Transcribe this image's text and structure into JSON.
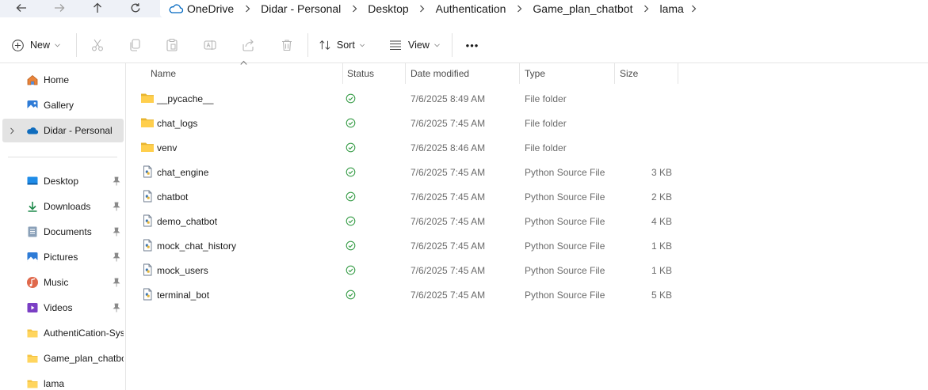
{
  "toolbar_nav": {
    "back_icon": "arrow-left-icon",
    "forward_icon": "arrow-right-icon",
    "up_icon": "arrow-up-icon",
    "refresh_icon": "refresh-icon"
  },
  "breadcrumb": {
    "items": [
      "OneDrive",
      "Didar - Personal",
      "Desktop",
      "Authentication",
      "Game_plan_chatbot",
      "lama"
    ]
  },
  "command_bar": {
    "new_label": "New",
    "sort_label": "Sort",
    "view_label": "View",
    "more_label": "•••"
  },
  "sidebar": {
    "top_items": [
      {
        "label": "Home",
        "icon": "home-icon"
      },
      {
        "label": "Gallery",
        "icon": "gallery-icon"
      },
      {
        "label": "Didar - Personal",
        "icon": "onedrive-icon",
        "selected": true
      }
    ],
    "quick_access": [
      {
        "label": "Desktop",
        "icon": "desktop-icon",
        "pinned": true
      },
      {
        "label": "Downloads",
        "icon": "download-icon",
        "pinned": true
      },
      {
        "label": "Documents",
        "icon": "documents-icon",
        "pinned": true
      },
      {
        "label": "Pictures",
        "icon": "pictures-icon",
        "pinned": true
      },
      {
        "label": "Music",
        "icon": "music-icon",
        "pinned": true
      },
      {
        "label": "Videos",
        "icon": "videos-icon",
        "pinned": true
      },
      {
        "label": "AuthentiCation-Sys",
        "icon": "folder-icon",
        "pinned": false
      },
      {
        "label": "Game_plan_chatbo",
        "icon": "folder-icon",
        "pinned": false
      },
      {
        "label": "lama",
        "icon": "folder-icon",
        "pinned": false
      }
    ]
  },
  "columns": {
    "name": "Name",
    "status": "Status",
    "date_modified": "Date modified",
    "type": "Type",
    "size": "Size"
  },
  "files": [
    {
      "name": "__pycache__",
      "date": "7/6/2025 8:49 AM",
      "type": "File folder",
      "size": "",
      "kind": "folder"
    },
    {
      "name": "chat_logs",
      "date": "7/6/2025 7:45 AM",
      "type": "File folder",
      "size": "",
      "kind": "folder"
    },
    {
      "name": "venv",
      "date": "7/6/2025 8:46 AM",
      "type": "File folder",
      "size": "",
      "kind": "folder"
    },
    {
      "name": "chat_engine",
      "date": "7/6/2025 7:45 AM",
      "type": "Python Source File",
      "size": "3 KB",
      "kind": "python"
    },
    {
      "name": "chatbot",
      "date": "7/6/2025 7:45 AM",
      "type": "Python Source File",
      "size": "2 KB",
      "kind": "python"
    },
    {
      "name": "demo_chatbot",
      "date": "7/6/2025 7:45 AM",
      "type": "Python Source File",
      "size": "4 KB",
      "kind": "python"
    },
    {
      "name": "mock_chat_history",
      "date": "7/6/2025 7:45 AM",
      "type": "Python Source File",
      "size": "1 KB",
      "kind": "python"
    },
    {
      "name": "mock_users",
      "date": "7/6/2025 7:45 AM",
      "type": "Python Source File",
      "size": "1 KB",
      "kind": "python"
    },
    {
      "name": "terminal_bot",
      "date": "7/6/2025 7:45 AM",
      "type": "Python Source File",
      "size": "5 KB",
      "kind": "python"
    }
  ],
  "colors": {
    "folder": "#f5c443",
    "status_synced": "#3a9e4a",
    "accent": "#0067c0"
  }
}
